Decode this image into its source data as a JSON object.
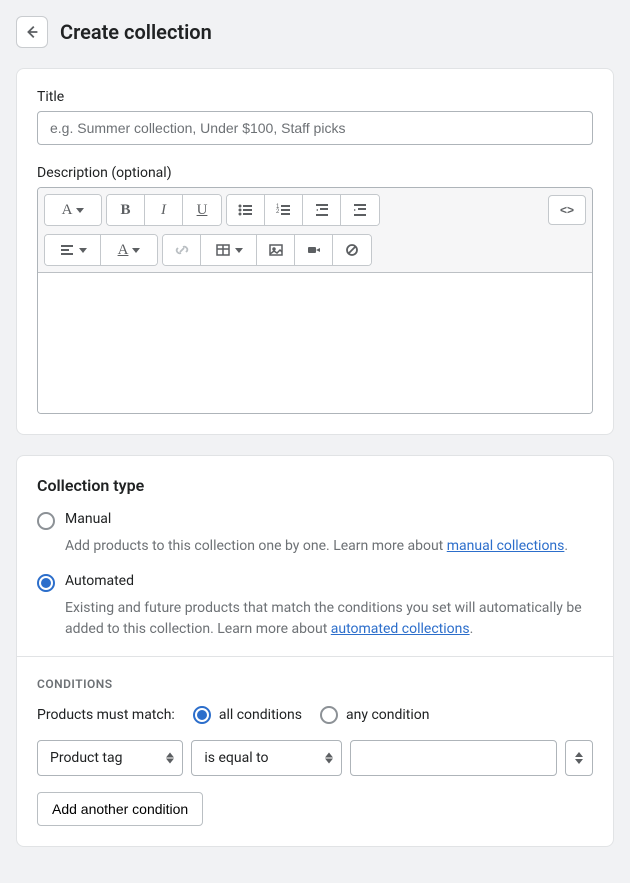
{
  "header": {
    "title": "Create collection"
  },
  "title_field": {
    "label": "Title",
    "placeholder": "e.g. Summer collection, Under $100, Staff picks",
    "value": ""
  },
  "description_field": {
    "label": "Description (optional)"
  },
  "rte": {
    "html_label": "<>"
  },
  "collection_type": {
    "heading": "Collection type",
    "manual": {
      "label": "Manual",
      "help_prefix": "Add products to this collection one by one. Learn more about ",
      "link": "manual collections",
      "help_suffix": "."
    },
    "automated": {
      "label": "Automated",
      "help_prefix": "Existing and future products that match the conditions you set will automatically be added to this collection. Learn more about ",
      "link": "automated collections",
      "help_suffix": "."
    },
    "selected": "automated"
  },
  "conditions": {
    "heading": "CONDITIONS",
    "match_label": "Products must match:",
    "all_label": "all conditions",
    "any_label": "any condition",
    "match_selected": "all",
    "rows": [
      {
        "field": "Product tag",
        "operator": "is equal to",
        "value": ""
      }
    ],
    "add_button": "Add another condition"
  }
}
